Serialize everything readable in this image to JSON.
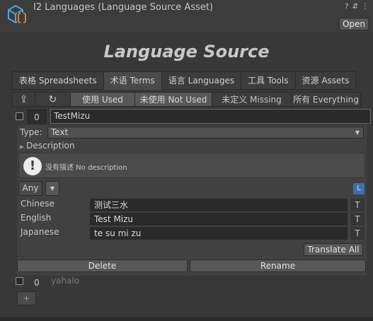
{
  "header": {
    "title": "I2 Languages (Language Source Asset)",
    "open_label": "Open",
    "help_glyph": "?",
    "settings_glyph": "⇵",
    "menu_glyph": "⋮"
  },
  "main": {
    "title": "Language Source"
  },
  "tabs": [
    {
      "label": "表格 Spreadsheets",
      "active": false
    },
    {
      "label": "术语 Terms",
      "active": true
    },
    {
      "label": "语言 Languages",
      "active": false
    },
    {
      "label": "工具 Tools",
      "active": false
    },
    {
      "label": "资源 Assets",
      "active": false
    }
  ],
  "filters": {
    "up_glyph": "⇪",
    "refresh_glyph": "↻",
    "used": "使用 Used",
    "not_used": "未使用 Not Used",
    "missing": "未定义 Missing",
    "everything": "所有 Everything"
  },
  "terms": [
    {
      "index": "0",
      "name": "TestMizu"
    },
    {
      "index": "0",
      "name": "yahalo"
    }
  ],
  "editor": {
    "type_label": "Type:",
    "type_value": "Text",
    "description_label": "Description",
    "info_icon_glyph": "!",
    "no_description": "没有描述 No description",
    "any_label": "Any",
    "dropdown_glyph": "▼",
    "l_label": "L",
    "languages": [
      {
        "name": "Chinese",
        "value": "测试三水",
        "t_label": "T"
      },
      {
        "name": "English",
        "value": "Test Mizu",
        "t_label": "T"
      },
      {
        "name": "Japanese",
        "value": "te su mi zu",
        "t_label": "T"
      }
    ],
    "translate_all": "Translate All",
    "delete": "Delete",
    "rename": "Rename"
  },
  "add_label": "+",
  "colors": {
    "background": "#383838",
    "panel": "#414141",
    "accent": "#3a72b0",
    "icon_blue": "#4fa7dc",
    "icon_orange": "#f08a24"
  }
}
